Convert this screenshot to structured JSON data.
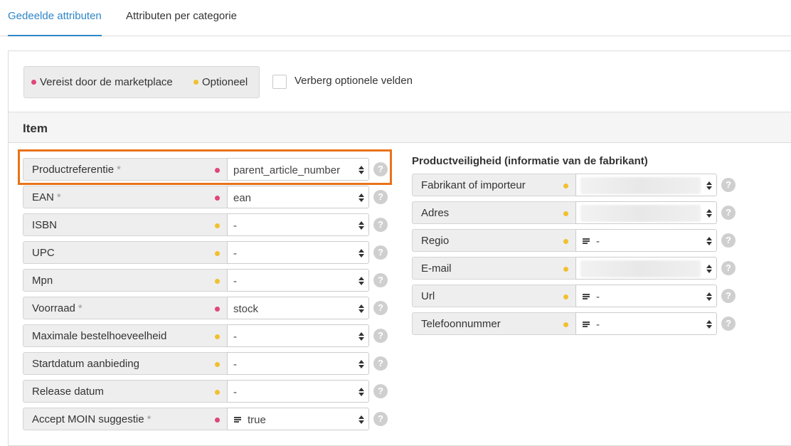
{
  "tabs": [
    {
      "label": "Gedeelde attributen",
      "active": true
    },
    {
      "label": "Attributen per categorie",
      "active": false
    }
  ],
  "legend": {
    "required_label": "Vereist door de marketplace",
    "optional_label": "Optioneel",
    "required_color": "#e0457b",
    "optional_color": "#f0c030"
  },
  "hide_optional": {
    "label": "Verberg optionele velden",
    "checked": false
  },
  "section": {
    "title": "Item"
  },
  "left_rows": [
    {
      "label": "Productreferentie",
      "required": true,
      "value": "parent_article_number"
    },
    {
      "label": "EAN",
      "required": true,
      "value": "ean"
    },
    {
      "label": "ISBN",
      "required": false,
      "value": "-"
    },
    {
      "label": "UPC",
      "required": false,
      "value": "-"
    },
    {
      "label": "Mpn",
      "required": false,
      "value": "-"
    },
    {
      "label": "Voorraad",
      "required": true,
      "value": "stock"
    },
    {
      "label": "Maximale bestelhoeveelheid",
      "required": false,
      "value": "-"
    },
    {
      "label": "Startdatum aanbieding",
      "required": false,
      "value": "-"
    },
    {
      "label": "Release datum",
      "required": false,
      "value": "-"
    },
    {
      "label": "Accept MOIN suggestie",
      "required": true,
      "value": "true",
      "icon": "text-lines-icon"
    }
  ],
  "right": {
    "title": "Productveiligheid (informatie van de fabrikant)",
    "rows": [
      {
        "label": "Fabrikant of importeur",
        "required": false,
        "value": "",
        "blurred": true
      },
      {
        "label": "Adres",
        "required": false,
        "value": "",
        "blurred": true
      },
      {
        "label": "Regio",
        "required": false,
        "value": "-",
        "icon": "text-lines-icon"
      },
      {
        "label": "E-mail",
        "required": false,
        "value": "",
        "blurred": true
      },
      {
        "label": "Url",
        "required": false,
        "value": "-",
        "icon": "text-lines-icon"
      },
      {
        "label": "Telefoonnummer",
        "required": false,
        "value": "-",
        "icon": "text-lines-icon"
      }
    ]
  },
  "required_marker": "*",
  "help_glyph": "?"
}
